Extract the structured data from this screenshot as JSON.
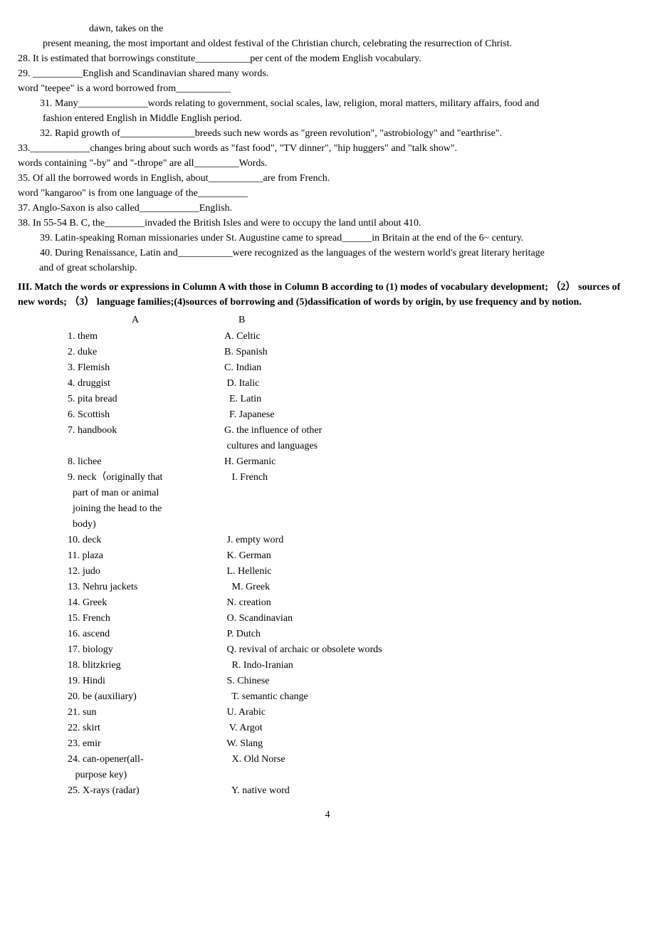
{
  "lines": {
    "l01": "dawn, takes on the",
    "l02": "present meaning, the most important and oldest festival of the Christian church, celebrating the resurrection of Christ.",
    "l03": "28. It is estimated that borrowings constitute___________per cent of the modem English vocabulary.",
    "l04": "29. __________English and Scandinavian shared many words.",
    "l05": " word \"teepee\" is a word borrowed from___________",
    "l06": "31. Many______________words relating to government, social scales, law, religion, moral matters, military affairs, food and",
    "l07": "fashion entered English in Middle English period.",
    "l08": "32. Rapid growth of_______________breeds such new words as \"green revolution\", \"astrobiology\" and \"earthrise\".",
    "l09": "33.____________changes bring about such words as \"fast food\", \"TV dinner\", \"hip huggers\" and \"talk show\".",
    "l10": " words containing \"-by\" and \"-thrope\" are all_________Words.",
    "l11": "35. Of all the borrowed words in English, about___________are from French.",
    "l12": " word \"kangaroo\" is from one language of the__________",
    "l13": "37. Anglo-Saxon is also called____________English.",
    "l14": "38. In 55-54 B. C, the________invaded the British Isles and were to occupy the land until about 410.",
    "l15": "39. Latin-speaking Roman missionaries under St. Augustine came to spread______in Britain at the end of the 6~ century.",
    "l16": "40. During Renaissance, Latin and___________were recognized as the languages of the western world's great literary heritage",
    "l17": "and of great scholarship.",
    "section3": "III. Match the words or expressions in Column A with those in Column B according to (1) modes of vocabulary development; （2） sources of new words; （3） language families;(4)sources of borrowing and (5)dassification of words by origin, by use frequency and by notion.",
    "headA": "A",
    "headB": "B"
  },
  "columnA": [
    "1. them",
    "2. duke",
    "3. Flemish",
    "4. druggist",
    "5. pita bread",
    "6. Scottish",
    "7. handbook",
    "",
    "8. lichee",
    "9. neck（originally that",
    "  part of man or animal",
    "  joining the head to the",
    "  body)",
    "10. deck",
    "11. plaza",
    "12. judo",
    "13. Nehru jackets",
    "14. Greek",
    "15. French",
    "16. ascend",
    "17. biology",
    "18. blitzkrieg",
    "19. Hindi",
    "20. be (auxiliary)",
    "21. sun",
    "22. skirt",
    "23. emir",
    "24. can-opener(all-",
    "   purpose key)",
    "25. X-rays (radar)"
  ],
  "columnB": [
    "A. Celtic",
    "B. Spanish",
    "C. Indian",
    " D. Italic",
    "  E. Latin",
    "  F. Japanese",
    "G. the influence of other",
    " cultures and languages",
    "H. Germanic",
    "   I. French",
    "",
    "",
    "",
    " J. empty word",
    " K. German",
    " L. Hellenic",
    "   M. Greek",
    " N. creation",
    " O. Scandinavian",
    " P. Dutch",
    " Q. revival of archaic or obsolete words",
    "   R. Indo-Iranian",
    " S. Chinese",
    "   T. semantic change",
    " U. Arabic",
    "  V. Argot",
    " W. Slang",
    "   X. Old Norse",
    "",
    "   Y. native word"
  ],
  "pageNum": "4"
}
